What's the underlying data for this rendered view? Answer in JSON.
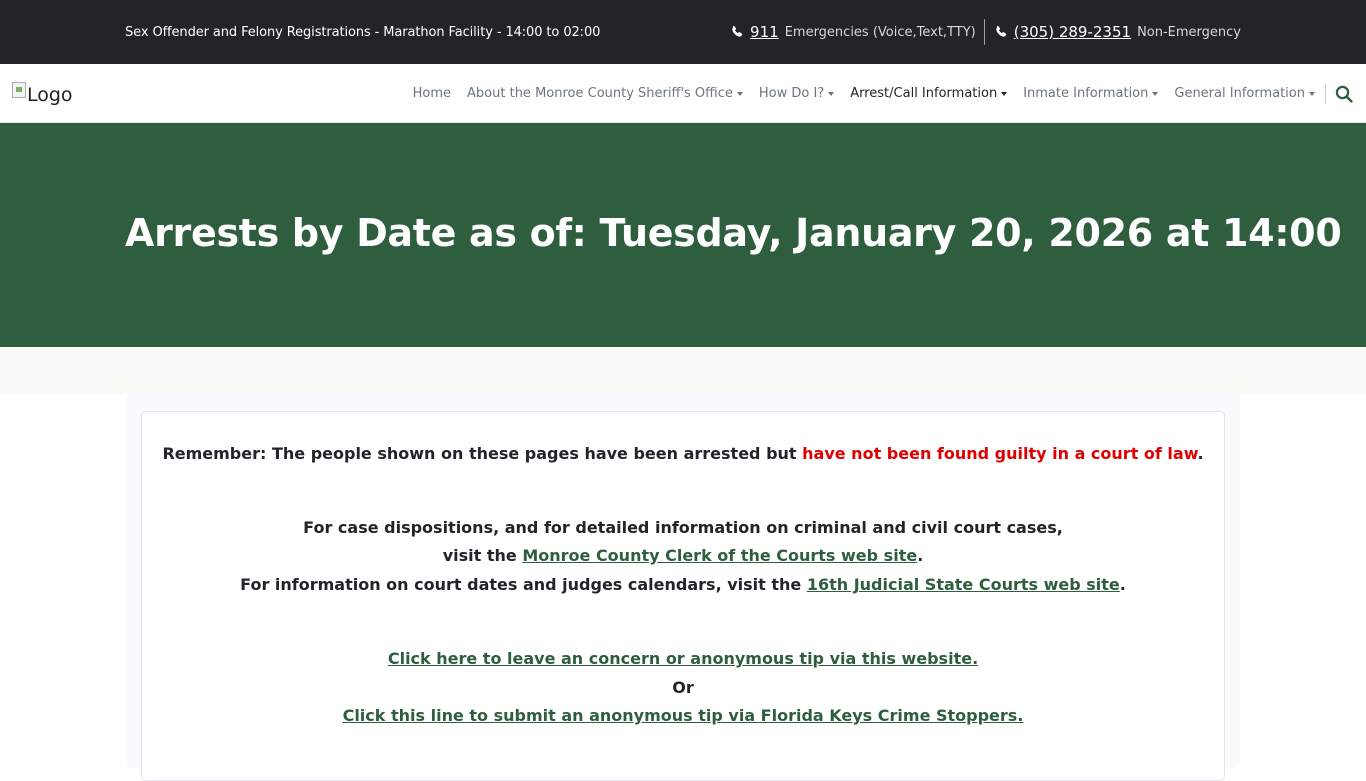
{
  "topbar": {
    "notice": "Sex Offender and Felony Registrations - Marathon Facility - 14:00 to 02:00",
    "emergency": {
      "number": "911",
      "label": "Emergencies (Voice,Text,TTY)"
    },
    "non_emergency": {
      "number": "(305) 289-2351",
      "label": "Non-Emergency"
    }
  },
  "navbar": {
    "logo_alt": "Logo",
    "items": [
      {
        "label": "Home",
        "dropdown": false
      },
      {
        "label": "About the Monroe County Sheriff's Office",
        "dropdown": true
      },
      {
        "label": "How Do I?",
        "dropdown": true
      },
      {
        "label": "Arrest/Call Information",
        "dropdown": true,
        "active": true
      },
      {
        "label": "Inmate Information",
        "dropdown": true
      },
      {
        "label": "General Information",
        "dropdown": true
      }
    ],
    "search_icon": "search-icon"
  },
  "hero": {
    "title": "Arrests by Date as of: Tuesday, January 20, 2026 at 14:00"
  },
  "card": {
    "remember_prefix": "Remember: The people shown on these pages have been arrested but ",
    "remember_warning": "have not been found guilty in a court of law",
    "remember_suffix": ".",
    "dispositions_line1": "For case dispositions, and for detailed information on criminal and civil court cases,",
    "dispositions_line2_prefix": "visit the ",
    "clerk_link": "Monroe County Clerk of the Courts web site",
    "dispositions_line2_suffix": ".",
    "court_dates_prefix": "For information on court dates and judges calendars, visit the ",
    "state_courts_link": "16th Judicial State Courts web site",
    "court_dates_suffix": ".",
    "tip_link": "Click here to leave an concern or anonymous tip via this website.",
    "or_text": "Or",
    "crime_stoppers_link": "Click this line to submit an anonymous tip via Florida Keys Crime Stoppers."
  },
  "colors": {
    "topbar_bg": "#212529",
    "brand_green": "#2e5e3e",
    "warning_red": "#e00000"
  }
}
